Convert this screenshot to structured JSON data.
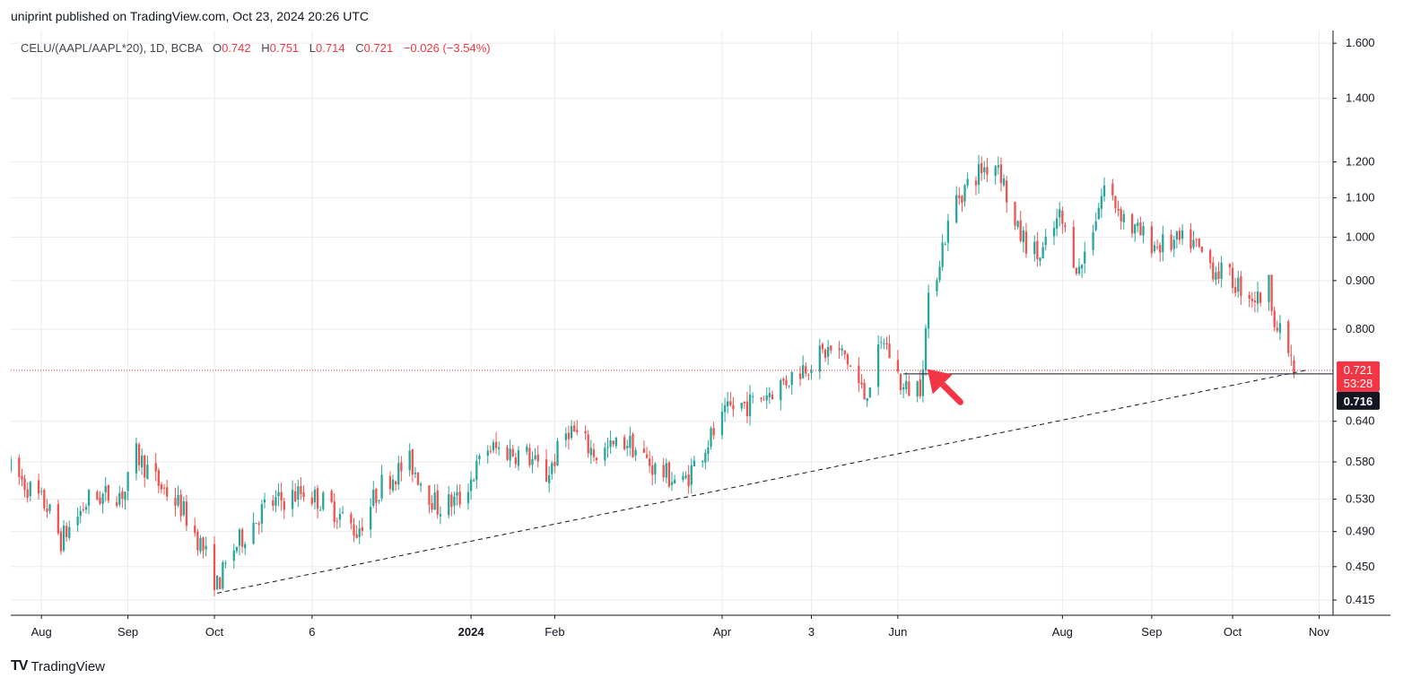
{
  "header": {
    "published_by": "uniprint published on TradingView.com, Oct 23, 2024 20:26 UTC"
  },
  "legend": {
    "symbol": "CELU/(AAPL/AAPL*20), 1D, BCBA",
    "open_label": "O",
    "open": "0.742",
    "high_label": "H",
    "high": "0.751",
    "low_label": "L",
    "low": "0.714",
    "close_label": "C",
    "close": "0.721",
    "change": "−0.026 (−3.54%)"
  },
  "brand": {
    "logo": "TV",
    "name": "TradingView"
  },
  "colors": {
    "up": "#26a69a",
    "down": "#ef5350",
    "grid": "#ebebeb",
    "axis": "#131722",
    "price_tag": "#f23645"
  },
  "chart_data": {
    "type": "candlestick",
    "scale": "log",
    "ylim": [
      0.4,
      1.65
    ],
    "y_ticks": [
      1.6,
      1.4,
      1.2,
      1.1,
      1.0,
      0.9,
      0.8,
      0.64,
      0.58,
      0.53,
      0.49,
      0.45,
      0.415
    ],
    "y_tick_labels": [
      "1.600",
      "1.400",
      "1.200",
      "1.100",
      "1.000",
      "0.900",
      "0.800",
      "0.640",
      "0.580",
      "0.530",
      "0.490",
      "0.450",
      "0.415"
    ],
    "x_ticks": [
      {
        "label": "Aug",
        "date": "2023-08-01",
        "bold": false
      },
      {
        "label": "Sep",
        "date": "2023-09-01",
        "bold": false
      },
      {
        "label": "Oct",
        "date": "2023-10-02",
        "bold": false
      },
      {
        "label": "6",
        "date": "2023-11-06",
        "bold": false
      },
      {
        "label": "2024",
        "date": "2024-01-02",
        "bold": true
      },
      {
        "label": "Feb",
        "date": "2024-02-01",
        "bold": false
      },
      {
        "label": "Apr",
        "date": "2024-04-01",
        "bold": false
      },
      {
        "label": "3",
        "date": "2024-05-03",
        "bold": false
      },
      {
        "label": "Jun",
        "date": "2024-06-03",
        "bold": false
      },
      {
        "label": "Aug",
        "date": "2024-08-01",
        "bold": false
      },
      {
        "label": "Sep",
        "date": "2024-09-02",
        "bold": false
      },
      {
        "label": "Oct",
        "date": "2024-10-01",
        "bold": false
      },
      {
        "label": "Nov",
        "date": "2024-11-01",
        "bold": false
      }
    ],
    "x_range": [
      "2023-07-21",
      "2024-11-06"
    ],
    "price_path": [
      [
        "2023-07-21",
        0.57
      ],
      [
        "2023-08-03",
        0.52
      ],
      [
        "2023-08-08",
        0.48
      ],
      [
        "2023-08-18",
        0.53
      ],
      [
        "2023-08-31",
        0.54
      ],
      [
        "2023-09-04",
        0.59
      ],
      [
        "2023-09-12",
        0.55
      ],
      [
        "2023-09-20",
        0.52
      ],
      [
        "2023-09-28",
        0.47
      ],
      [
        "2023-10-03",
        0.43
      ],
      [
        "2023-10-09",
        0.47
      ],
      [
        "2023-10-20",
        0.52
      ],
      [
        "2023-11-03",
        0.54
      ],
      [
        "2023-11-13",
        0.52
      ],
      [
        "2023-11-22",
        0.49
      ],
      [
        "2023-12-01",
        0.55
      ],
      [
        "2023-12-11",
        0.58
      ],
      [
        "2023-12-21",
        0.52
      ],
      [
        "2023-12-29",
        0.53
      ],
      [
        "2024-01-08",
        0.6
      ],
      [
        "2024-01-22",
        0.59
      ],
      [
        "2024-01-29",
        0.56
      ],
      [
        "2024-02-06",
        0.63
      ],
      [
        "2024-02-16",
        0.59
      ],
      [
        "2024-02-27",
        0.61
      ],
      [
        "2024-03-08",
        0.57
      ],
      [
        "2024-03-18",
        0.55
      ],
      [
        "2024-03-27",
        0.61
      ],
      [
        "2024-04-04",
        0.66
      ],
      [
        "2024-04-12",
        0.67
      ],
      [
        "2024-04-22",
        0.7
      ],
      [
        "2024-04-30",
        0.73
      ],
      [
        "2024-05-09",
        0.76
      ],
      [
        "2024-05-15",
        0.75
      ],
      [
        "2024-05-22",
        0.68
      ],
      [
        "2024-05-29",
        0.78
      ],
      [
        "2024-06-05",
        0.69
      ],
      [
        "2024-06-11",
        0.7
      ],
      [
        "2024-06-14",
        0.85
      ],
      [
        "2024-06-19",
        0.98
      ],
      [
        "2024-06-24",
        1.1
      ],
      [
        "2024-07-03",
        1.18
      ],
      [
        "2024-07-09",
        1.2
      ],
      [
        "2024-07-15",
        1.02
      ],
      [
        "2024-07-24",
        0.95
      ],
      [
        "2024-07-31",
        1.05
      ],
      [
        "2024-08-07",
        0.92
      ],
      [
        "2024-08-16",
        1.13
      ],
      [
        "2024-08-26",
        1.02
      ],
      [
        "2024-09-04",
        0.98
      ],
      [
        "2024-09-16",
        0.99
      ],
      [
        "2024-09-24",
        0.93
      ],
      [
        "2024-10-01",
        0.9
      ],
      [
        "2024-10-10",
        0.86
      ],
      [
        "2024-10-14",
        0.89
      ],
      [
        "2024-10-17",
        0.8
      ],
      [
        "2024-10-21",
        0.76
      ],
      [
        "2024-10-23",
        0.721
      ]
    ],
    "trendline": {
      "start": [
        "2023-10-03",
        0.422
      ],
      "end": [
        "2024-10-27",
        0.724
      ],
      "style": "dashed"
    },
    "support_line": {
      "start": [
        "2024-06-05",
        0.721
      ],
      "end": [
        "2024-11-06",
        0.721
      ]
    },
    "last_price": 0.721,
    "last_price_label": "0.721",
    "countdown": "53:28",
    "crosshair_price_label": "0.716",
    "annotation": {
      "type": "arrow",
      "color": "#f23645",
      "points_to": [
        "2024-06-11",
        0.72
      ]
    }
  }
}
